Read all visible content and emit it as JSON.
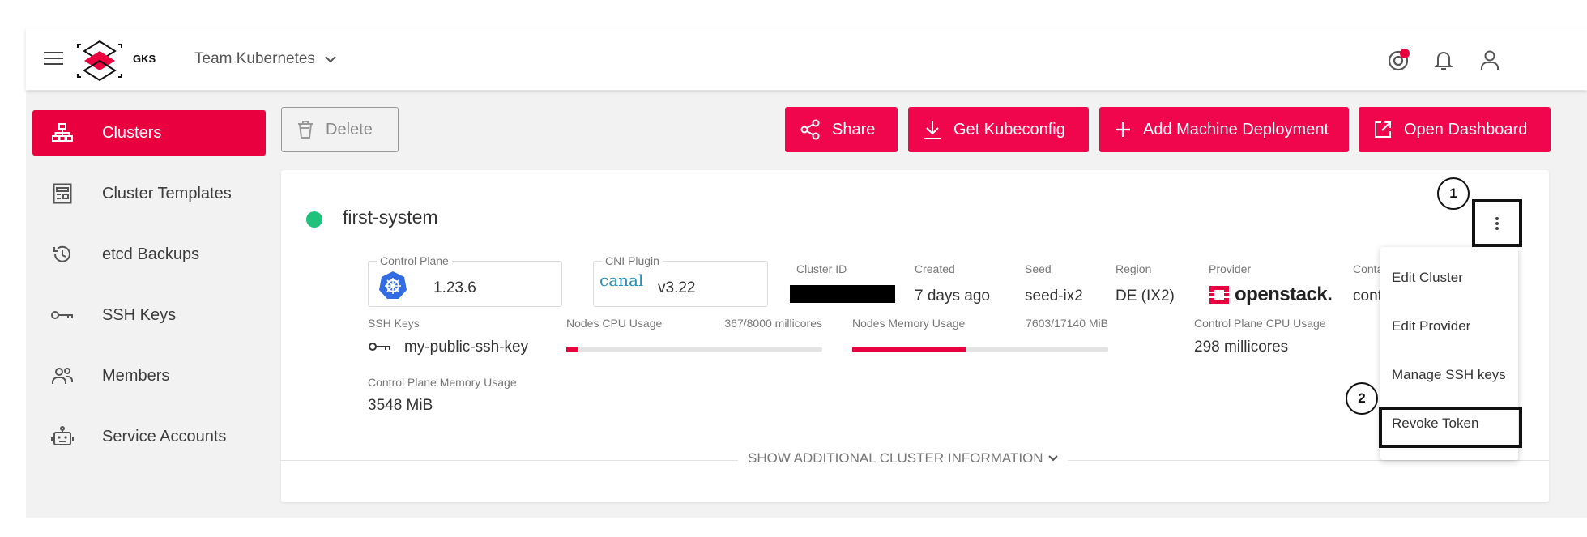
{
  "brand": {
    "name": "GKS"
  },
  "header": {
    "team": "Team Kubernetes"
  },
  "sidebar": {
    "items": [
      {
        "label": "Clusters",
        "icon": "sitemap-icon",
        "active": true
      },
      {
        "label": "Cluster Templates",
        "icon": "template-icon"
      },
      {
        "label": "etcd Backups",
        "icon": "history-icon"
      },
      {
        "label": "SSH Keys",
        "icon": "key-icon"
      },
      {
        "label": "Members",
        "icon": "people-icon"
      },
      {
        "label": "Service Accounts",
        "icon": "robot-icon"
      }
    ]
  },
  "toolbar": {
    "delete": "Delete",
    "share": "Share",
    "kubeconfig": "Get Kubeconfig",
    "add_md": "Add Machine Deployment",
    "dashboard": "Open Dashboard"
  },
  "cluster": {
    "name": "first-system",
    "control_plane": {
      "label": "Control Plane",
      "value": "1.23.6"
    },
    "cni": {
      "label": "CNI Plugin",
      "logo": "canal",
      "value": "v3.22"
    },
    "cluster_id_label": "Cluster ID",
    "created": {
      "label": "Created",
      "value": "7 days ago"
    },
    "seed": {
      "label": "Seed",
      "value": "seed-ix2"
    },
    "region": {
      "label": "Region",
      "value": "DE (IX2)"
    },
    "provider": {
      "label": "Provider",
      "value": "openstack."
    },
    "container": {
      "label": "Container",
      "value": "containe"
    },
    "ssh": {
      "label": "SSH Keys",
      "value": "my-public-ssh-key"
    },
    "cpu": {
      "label": "Nodes CPU Usage",
      "value": "367/8000 millicores",
      "ratio": 0.046
    },
    "mem": {
      "label": "Nodes Memory Usage",
      "value": "7603/17140 MiB",
      "ratio": 0.444
    },
    "cp_cpu": {
      "label": "Control Plane CPU Usage",
      "value": "298 millicores"
    },
    "cp_mem": {
      "label": "Control Plane Memory Usage",
      "value": "3548 MiB"
    },
    "more": "SHOW ADDITIONAL CLUSTER INFORMATION"
  },
  "menu": {
    "items": [
      "Edit Cluster",
      "Edit Provider",
      "Manage SSH keys",
      "Revoke Token"
    ]
  },
  "callouts": {
    "one": "1",
    "two": "2"
  },
  "colors": {
    "accent": "#e8003f",
    "status": "#1fc27b"
  }
}
